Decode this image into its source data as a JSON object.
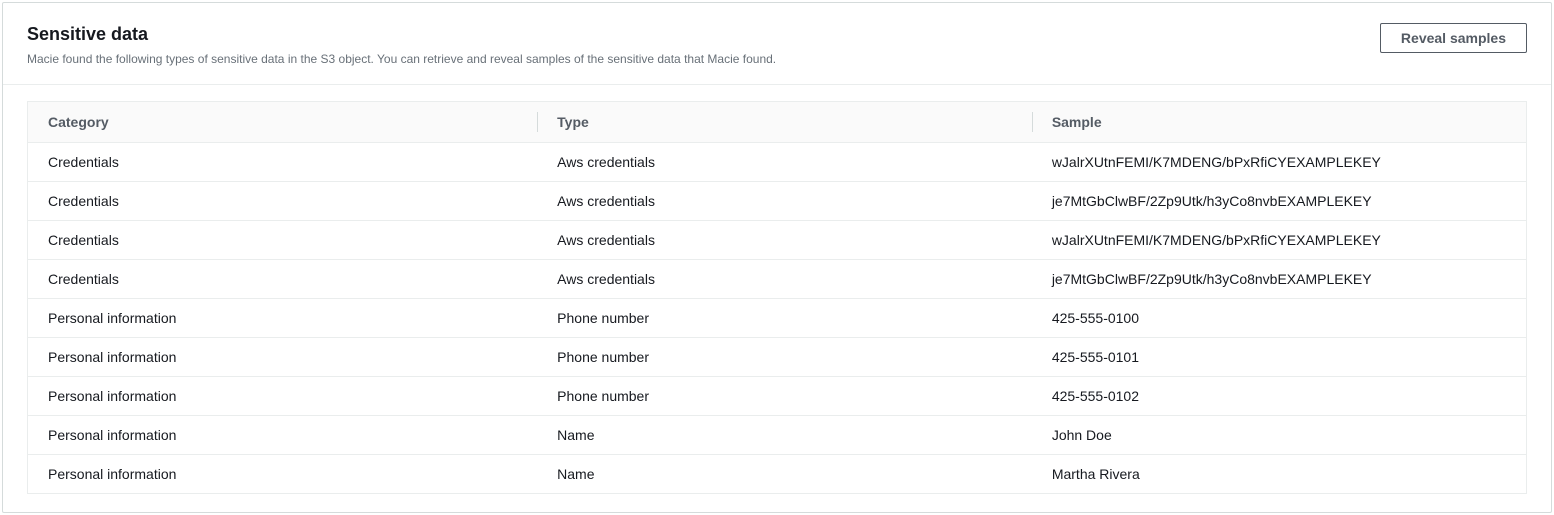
{
  "panel": {
    "title": "Sensitive data",
    "description": "Macie found the following types of sensitive data in the S3 object. You can retrieve and reveal samples of the sensitive data that Macie found.",
    "reveal_button": "Reveal samples"
  },
  "table": {
    "headers": {
      "category": "Category",
      "type": "Type",
      "sample": "Sample"
    },
    "rows": [
      {
        "category": "Credentials",
        "type": "Aws credentials",
        "sample": "wJalrXUtnFEMI/K7MDENG/bPxRfiCYEXAMPLEKEY"
      },
      {
        "category": "Credentials",
        "type": "Aws credentials",
        "sample": "je7MtGbClwBF/2Zp9Utk/h3yCo8nvbEXAMPLEKEY"
      },
      {
        "category": "Credentials",
        "type": "Aws credentials",
        "sample": "wJalrXUtnFEMI/K7MDENG/bPxRfiCYEXAMPLEKEY"
      },
      {
        "category": "Credentials",
        "type": "Aws credentials",
        "sample": "je7MtGbClwBF/2Zp9Utk/h3yCo8nvbEXAMPLEKEY"
      },
      {
        "category": "Personal information",
        "type": "Phone number",
        "sample": "425-555-0100"
      },
      {
        "category": "Personal information",
        "type": "Phone number",
        "sample": "425-555-0101"
      },
      {
        "category": "Personal information",
        "type": "Phone number",
        "sample": "425-555-0102"
      },
      {
        "category": "Personal information",
        "type": "Name",
        "sample": "John Doe"
      },
      {
        "category": "Personal information",
        "type": "Name",
        "sample": "Martha Rivera"
      }
    ]
  }
}
